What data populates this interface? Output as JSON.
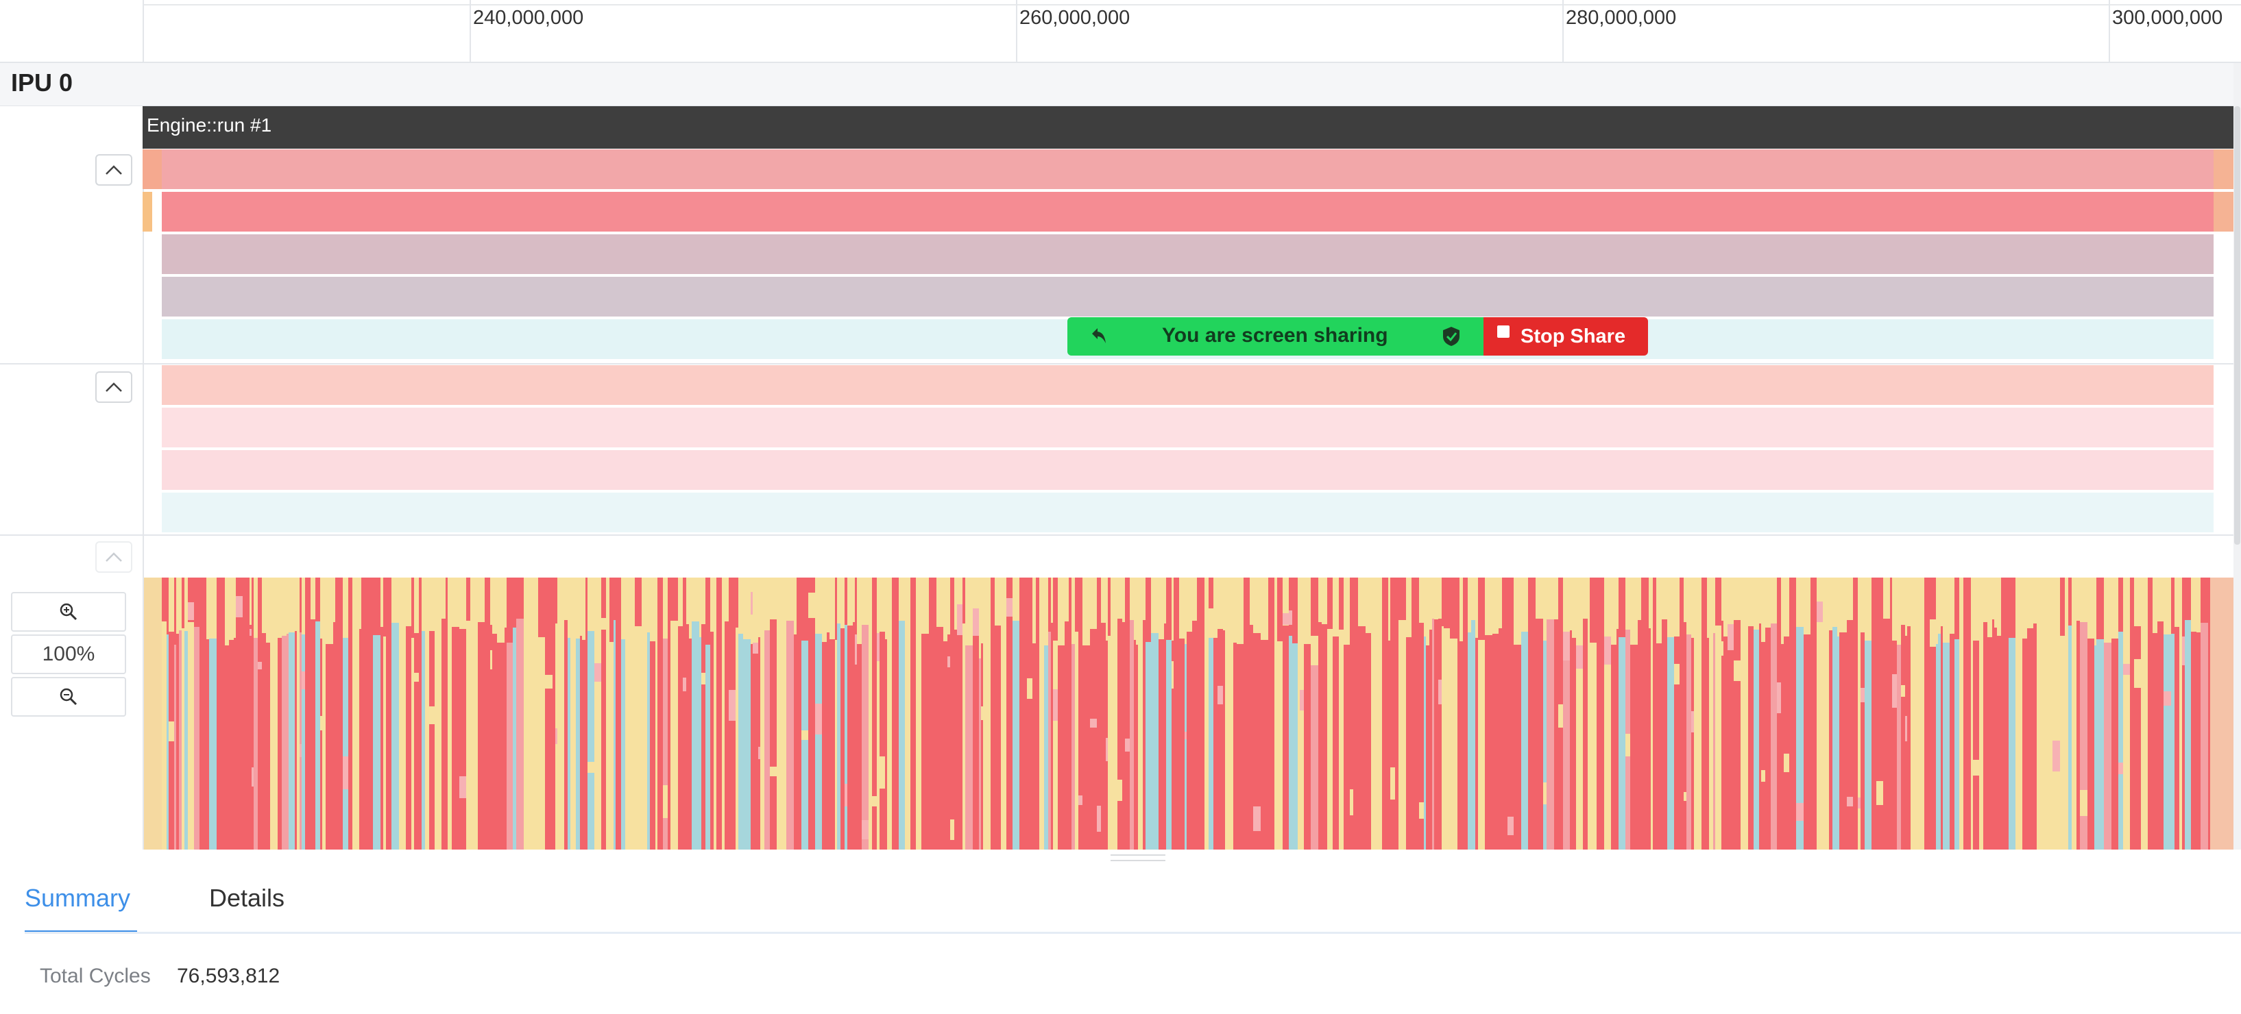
{
  "ruler": {
    "ticks": [
      "240,000,000",
      "260,000,000",
      "280,000,000",
      "300,000,000"
    ]
  },
  "ipu": {
    "label": "IPU 0"
  },
  "engine": {
    "label": "Engine::run #1"
  },
  "screen_share": {
    "message": "You are screen sharing",
    "stop_label": "Stop Share",
    "color_bar": "#22d45c",
    "color_stop": "#e42a2a"
  },
  "zoom": {
    "level": "100%"
  },
  "tabs": {
    "summary": "Summary",
    "details": "Details",
    "active": "Summary"
  },
  "summary": {
    "total_cycles_label": "Total Cycles",
    "total_cycles_value": "76,593,812"
  },
  "colors": {
    "accent": "#3d8fe8",
    "track_coral": "#f2a7a9",
    "track_red": "#f58c93",
    "track_mauve": "#d3c4cc",
    "track_cyan": "#e3f4f6",
    "track_salmon": "#fbcdc6",
    "track_pink": "#fde0e3",
    "heat_red": "#f2636a",
    "heat_yellow": "#f7e1a0",
    "heat_cyan": "#a6d6dc"
  }
}
